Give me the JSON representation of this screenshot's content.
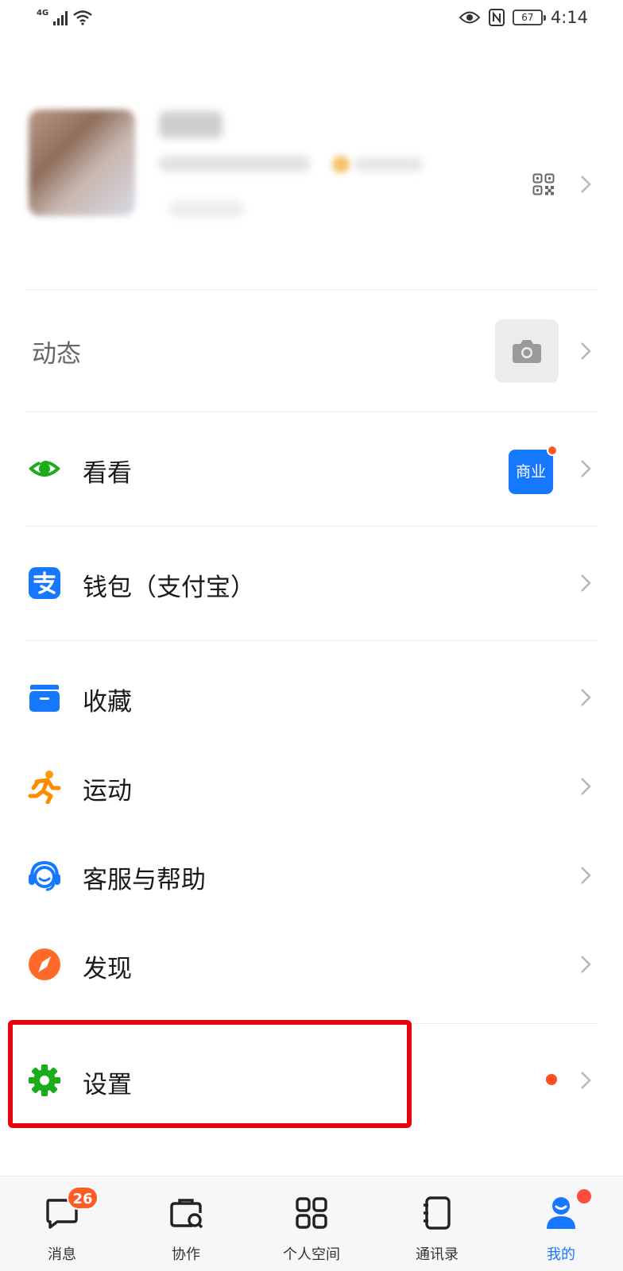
{
  "status_bar": {
    "network": "4G",
    "battery": "67",
    "time": "4:14"
  },
  "profile": {
    "qr_icon": "qr-code-icon"
  },
  "moments": {
    "label": "动态",
    "camera_icon": "camera-icon"
  },
  "menu": {
    "kankan": {
      "label": "看看",
      "icon": "eye-icon",
      "badge": "商业"
    },
    "wallet": {
      "label": "钱包（支付宝）",
      "icon": "alipay-icon"
    },
    "favorites": {
      "label": "收藏",
      "icon": "folder-icon"
    },
    "sport": {
      "label": "运动",
      "icon": "running-icon"
    },
    "service": {
      "label": "客服与帮助",
      "icon": "headset-icon"
    },
    "discover": {
      "label": "发现",
      "icon": "compass-icon"
    },
    "settings": {
      "label": "设置",
      "icon": "gear-icon"
    }
  },
  "tabbar": {
    "messages": {
      "label": "消息",
      "badge": "26"
    },
    "collab": {
      "label": "协作"
    },
    "space": {
      "label": "个人空间"
    },
    "contacts": {
      "label": "通讯录"
    },
    "me": {
      "label": "我的"
    }
  },
  "colors": {
    "accent": "#1677ff",
    "highlight_border": "#e8000f",
    "badge": "#ff5a24",
    "settings_green": "#1aad19"
  }
}
